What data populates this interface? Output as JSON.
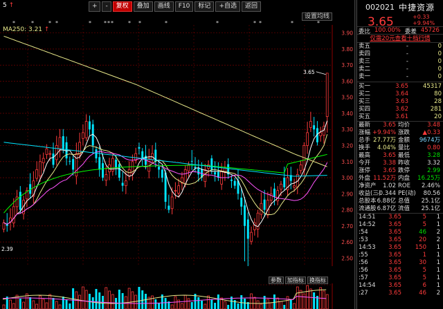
{
  "topbar": {
    "ma_prefix": "5",
    "ma_arrow": "↑",
    "ma250": "MA250: 3.21",
    "ma250_arrow": "↑",
    "buttons": [
      {
        "label": "+",
        "style": "normal"
      },
      {
        "label": "-",
        "style": "normal"
      },
      {
        "label": "复权",
        "style": "red"
      },
      {
        "label": "叠加",
        "style": "normal"
      },
      {
        "label": "画线",
        "style": "normal"
      },
      {
        "label": "F10",
        "style": "normal"
      },
      {
        "label": "标记",
        "style": "normal"
      },
      {
        "label": "+自选",
        "style": "normal"
      },
      {
        "label": "返回",
        "style": "normal"
      }
    ],
    "set_ma_label": "设置均线"
  },
  "chart": {
    "y_ticks": [
      "3.90",
      "3.80",
      "3.70",
      "3.60",
      "3.50",
      "3.40",
      "3.30",
      "3.20",
      "3.10",
      "3.00",
      "2.90",
      "2.80",
      "2.70",
      "2.60",
      "2.50"
    ],
    "high_label": "3.65",
    "low_label": "2.39",
    "colors": {
      "up": "#ff3b3b",
      "down": "#00e5ff",
      "ma5": "#ffffff",
      "ma10": "#e8e88a",
      "ma20": "#ff55ff",
      "ma60": "#00ff00",
      "ma250": "#e8e88a",
      "grid": "#8b0000"
    }
  },
  "indicator_toolbar": [
    "参数",
    "加指标",
    "换指标"
  ],
  "vol_ticks": [
    "",
    ""
  ],
  "quote": {
    "code": "002021",
    "name": "中捷资源",
    "price": "3.65",
    "change": "+0.33",
    "change_pct": "+9.94%",
    "webi_label": "委比",
    "webi_value": "100.00%",
    "weicha_label": "委差",
    "weicha_value": "45726",
    "l2_link": "仅需20元查看十档行情"
  },
  "orderbook": {
    "sells": [
      {
        "label": "卖五",
        "price": "-",
        "vol": "0"
      },
      {
        "label": "卖四",
        "price": "-",
        "vol": "0"
      },
      {
        "label": "卖三",
        "price": "-",
        "vol": "0"
      },
      {
        "label": "卖二",
        "price": "-",
        "vol": "0"
      },
      {
        "label": "卖一",
        "price": "-",
        "vol": "0"
      }
    ],
    "buys": [
      {
        "label": "买一",
        "price": "3.65",
        "vol": "45317"
      },
      {
        "label": "买二",
        "price": "3.64",
        "vol": "80"
      },
      {
        "label": "买三",
        "price": "3.63",
        "vol": "28"
      },
      {
        "label": "买四",
        "price": "3.62",
        "vol": "281"
      },
      {
        "label": "买五",
        "price": "3.61",
        "vol": "20"
      }
    ]
  },
  "stats": [
    {
      "k1": "最新",
      "v1": "3.65",
      "c1": "red",
      "k2": "均价",
      "v2": "3.48",
      "c2": "red"
    },
    {
      "k1": "涨幅",
      "v1": "+9.94%",
      "c1": "red",
      "k2": "涨跌",
      "v2": "▲0.33",
      "c2": "red"
    },
    {
      "k1": "总手",
      "v1": "27.77万",
      "c1": "yel",
      "k2": "金额",
      "v2": "9674万",
      "c2": "cy"
    },
    {
      "k1": "换手",
      "v1": "4.04%",
      "c1": "yel",
      "k2": "量比",
      "v2": "0.80",
      "c2": "red"
    },
    {
      "k1": "最高",
      "v1": "3.65",
      "c1": "red",
      "k2": "最低",
      "v2": "3.28",
      "c2": "green"
    },
    {
      "k1": "今开",
      "v1": "3.38",
      "c1": "red",
      "k2": "昨收",
      "v2": "3.32",
      "c2": "lbl"
    },
    {
      "k1": "涨停",
      "v1": "3.65",
      "c1": "red",
      "k2": "跌停",
      "v2": "2.99",
      "c2": "green"
    },
    {
      "k1": "外盘",
      "v1": "11.52万",
      "c1": "red",
      "k2": "内盘",
      "v2": "16.25万",
      "c2": "green"
    },
    {
      "k1": "净资产",
      "v1": "1.02",
      "c1": "lbl",
      "k2": "ROE",
      "v2": "2.46%",
      "c2": "lbl"
    },
    {
      "k1": "收益(三)",
      "v1": "-0.344",
      "c1": "lbl",
      "k2": "PE(动)",
      "v2": "80.56",
      "c2": "lbl"
    },
    {
      "k1": "总股本",
      "v1": "6.88亿",
      "c1": "lbl",
      "k2": "总值",
      "v2": "25.1亿",
      "c2": "lbl"
    },
    {
      "k1": "流通股",
      "v1": "6.87亿",
      "c1": "lbl",
      "k2": "流值",
      "v2": "25.1亿",
      "c2": "lbl"
    }
  ],
  "ticks": [
    {
      "time": "14:51",
      "price": "3.65",
      "vol": "5",
      "vc": "red",
      "n": "1"
    },
    {
      "time": "14:52",
      "price": "3.65",
      "vol": "5",
      "vc": "red",
      "n": "1"
    },
    {
      "time": ":54",
      "price": "3.65",
      "vol": "46",
      "vc": "green",
      "n": "2"
    },
    {
      "time": ":53",
      "price": "3.65",
      "vol": "20",
      "vc": "red",
      "n": "2"
    },
    {
      "time": "14:53",
      "price": "3.65",
      "vol": "150",
      "vc": "red",
      "n": "1"
    },
    {
      "time": ":55",
      "price": "3.65",
      "vol": "1",
      "vc": "red",
      "n": "1"
    },
    {
      "time": ":56",
      "price": "3.65",
      "vol": "30",
      "vc": "red",
      "n": "1"
    },
    {
      "time": ":56",
      "price": "3.65",
      "vol": "5",
      "vc": "red",
      "n": "1"
    },
    {
      "time": ":57",
      "price": "3.65",
      "vol": "5",
      "vc": "red",
      "n": "1"
    },
    {
      "time": "14:54",
      "price": "3.65",
      "vol": "6",
      "vc": "red",
      "n": "1"
    },
    {
      "time": ":27",
      "price": "3.65",
      "vol": "46",
      "vc": "red",
      "n": "2"
    }
  ]
}
